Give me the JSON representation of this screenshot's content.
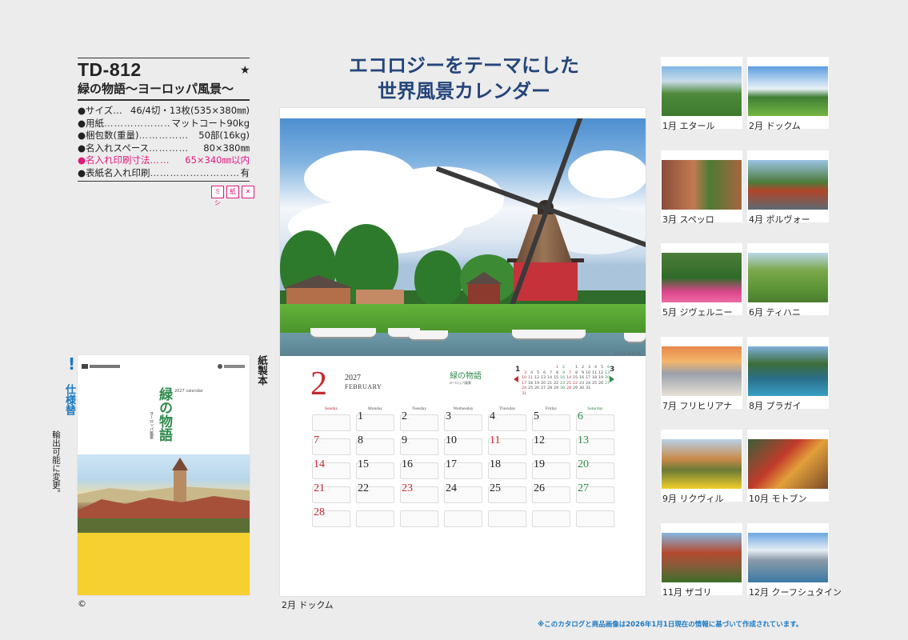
{
  "product": {
    "code": "TD-812",
    "star": "★",
    "name": "緑の物語〜ヨーロッパ風景〜"
  },
  "specs": [
    {
      "label": "●サイズ…",
      "dots": "",
      "value": "46/4切・13枚(535×380㎜)"
    },
    {
      "label": "●用紙",
      "dots": "…………………",
      "value": "マットコート90kg"
    },
    {
      "label": "●梱包数(重量)",
      "dots": "……………",
      "value": "50部(16kg)"
    },
    {
      "label": "●名入れスペース",
      "dots": "…………",
      "value": "80×380㎜"
    },
    {
      "label": "●名入れ印刷寸法",
      "dots": "……",
      "value": "65×340㎜以内"
    },
    {
      "label": "●表紙名入れ印刷",
      "dots": "……………………………",
      "value": "有"
    }
  ],
  "badges": [
    "ミシ",
    "紙",
    "✕"
  ],
  "spec_change": {
    "mark": "!",
    "title": "仕様替",
    "note": "輸出可能に変更。"
  },
  "cover": {
    "title": "緑の物語",
    "year": "2027 calendar",
    "sub": "ヨーロッパ風景",
    "binding": "紙製本"
  },
  "copyright": "©",
  "headline": {
    "line1": "エコロジーをテーマにした",
    "line2": "世界風景カレンダー"
  },
  "calendar": {
    "credit": "",
    "month_number": "2",
    "year": "2027",
    "month_en": "FEBRUARY",
    "brand": "緑の物語",
    "brand_sub": "ヨーロッパ風景",
    "prev_month": "1",
    "next_month": "3",
    "weekdays": [
      "Sunday",
      "Monday",
      "Tuesday",
      "Wednesday",
      "Thursday",
      "Friday",
      "Saturday"
    ],
    "photo_caption_right": "ドックム オランダ",
    "caption": "2月 ドックム"
  },
  "thumbnails": [
    {
      "caption": "1月 エタール"
    },
    {
      "caption": "2月 ドックム"
    },
    {
      "caption": "3月 スペッロ"
    },
    {
      "caption": "4月 ポルヴォー"
    },
    {
      "caption": "5月 ジヴェルニー"
    },
    {
      "caption": "6月 ティハニ"
    },
    {
      "caption": "7月 フリヒリアナ"
    },
    {
      "caption": "8月 プラガイ"
    },
    {
      "caption": "9月 リクヴィル"
    },
    {
      "caption": "10月 モトブン"
    },
    {
      "caption": "11月 ザゴリ"
    },
    {
      "caption": "12月 クーフシュタイン"
    }
  ],
  "footnote": "※このカタログと商品画像は2026年1月1日現在の情報に基づいて作成されています。",
  "colors": {
    "headline": "#24457a",
    "accent_pink": "#e0197d",
    "accent_blue": "#1a78c2",
    "sunday": "#c22a30",
    "saturday": "#2d8a4a"
  }
}
